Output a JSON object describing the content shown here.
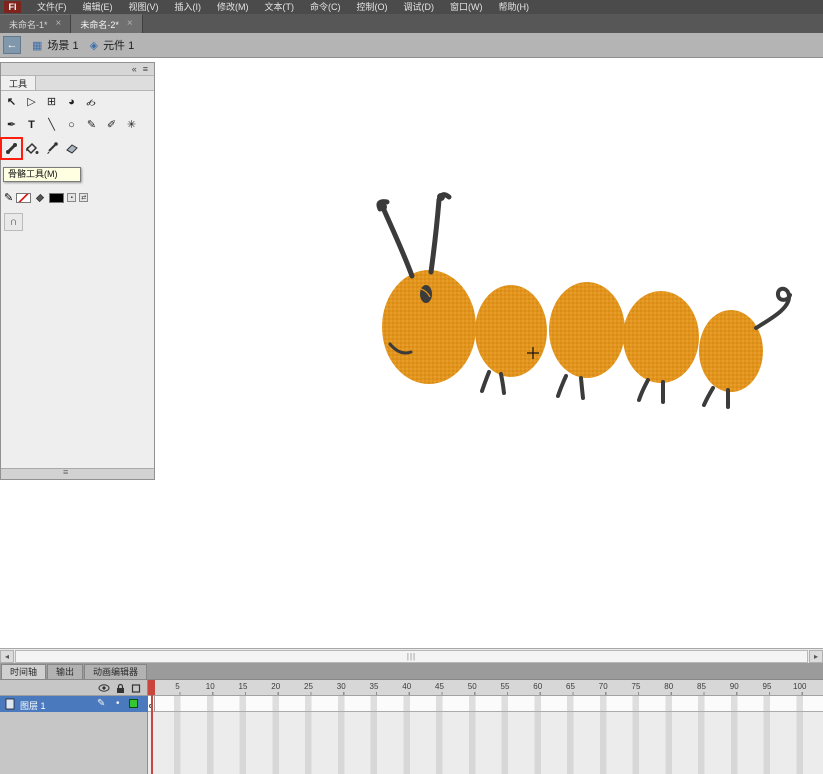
{
  "window": {
    "logo": "Fl"
  },
  "menu_bar": {
    "items": [
      "文件(F)",
      "编辑(E)",
      "视图(V)",
      "插入(I)",
      "修改(M)",
      "文本(T)",
      "命令(C)",
      "控制(O)",
      "调试(D)",
      "窗口(W)",
      "帮助(H)"
    ]
  },
  "document_tabs": [
    {
      "label": "未命名-1*",
      "close": "×",
      "active": false
    },
    {
      "label": "未命名-2*",
      "close": "×",
      "active": true
    }
  ],
  "scene_bar": {
    "back_arrow": "←",
    "scene_icon": "▦",
    "scene_label": "场景 1",
    "symbol_icon": "◈",
    "symbol_label": "元件 1"
  },
  "tools_panel": {
    "title": "工具",
    "collapse_icon": "«",
    "menu_icon": "≡",
    "tooltip": "骨骼工具(M)",
    "grip_icon": "≡",
    "icons": {
      "selection": "↖",
      "subselection": "▷",
      "free_transform": "⊞",
      "rotate_3d": "◕",
      "lasso": "℘",
      "pen": "✒",
      "text": "T",
      "line": "╲",
      "oval": "○",
      "pencil": "✎",
      "brush": "✐",
      "deco_spray": "✳",
      "stroke_pencil": "✎",
      "snap_magnet": "∩"
    }
  },
  "scrollbar": {
    "left_arrow": "◂",
    "right_arrow": "▸",
    "grip": "|||"
  },
  "timeline": {
    "tabs": [
      {
        "label": "时间轴",
        "active": true
      },
      {
        "label": "输出",
        "active": false
      },
      {
        "label": "动画编辑器",
        "active": false
      }
    ],
    "layer": {
      "name": "图层 1",
      "pencil_icon": "✎",
      "status_dot": "•"
    },
    "ruler_numbers": [
      5,
      10,
      15,
      20,
      25,
      30,
      35,
      40,
      45,
      50,
      55,
      60,
      65,
      70,
      75,
      80,
      85,
      90,
      95,
      100
    ],
    "playhead_frame": 1
  },
  "colors": {
    "body_orange": "#E2941C",
    "body_dot_dark": "#CE820C",
    "ink": "#3B3B3B",
    "selection_red": "#FF1D10",
    "layer_row_blue": "#4A79BD",
    "playhead_red": "#C8463C",
    "tooltip_bg": "#FFFFE1",
    "layer_outline_green": "#35C72F"
  }
}
